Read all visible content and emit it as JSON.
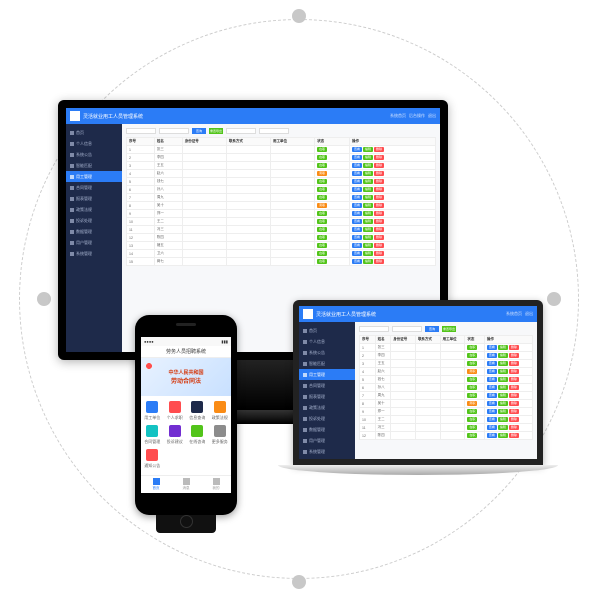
{
  "desktop": {
    "title": "灵活就业用工人员管理系统",
    "header_actions": [
      "系统首页",
      "后台操作",
      "退出"
    ],
    "sidebar": [
      {
        "label": "首页"
      },
      {
        "label": "个人信息"
      },
      {
        "label": "系统公告"
      },
      {
        "label": "智能匹配"
      },
      {
        "label": "用工管理",
        "active": true
      },
      {
        "label": "合同管理"
      },
      {
        "label": "报表管理"
      },
      {
        "label": "政策法规"
      },
      {
        "label": "投诉处理"
      },
      {
        "label": "数据管理"
      },
      {
        "label": "用户管理"
      },
      {
        "label": "系统管理"
      }
    ],
    "filter": {
      "search_btn": "查询",
      "reset_btn": "重置导出"
    },
    "columns": [
      "序号",
      "姓名",
      "身份证号",
      "联系方式",
      "用工单位",
      "状态",
      "操作"
    ],
    "rows": [
      {
        "c1": "1",
        "c2": "张三",
        "c3": "",
        "status": "在职",
        "actions": [
          "查看",
          "编辑",
          "删除"
        ]
      },
      {
        "c1": "2",
        "c2": "李四",
        "c3": "",
        "status": "在职",
        "actions": [
          "查看",
          "编辑",
          "删除"
        ]
      },
      {
        "c1": "3",
        "c2": "王五",
        "c3": "",
        "status": "在职",
        "actions": [
          "查看",
          "编辑",
          "删除"
        ]
      },
      {
        "c1": "4",
        "c2": "赵六",
        "c3": "",
        "status": "离职",
        "actions": [
          "查看",
          "编辑",
          "删除"
        ]
      },
      {
        "c1": "5",
        "c2": "钱七",
        "c3": "",
        "status": "在职",
        "actions": [
          "查看",
          "编辑",
          "删除"
        ]
      },
      {
        "c1": "6",
        "c2": "孙八",
        "c3": "",
        "status": "在职",
        "actions": [
          "查看",
          "编辑",
          "删除"
        ]
      },
      {
        "c1": "7",
        "c2": "周九",
        "c3": "",
        "status": "在职",
        "actions": [
          "查看",
          "编辑",
          "删除"
        ]
      },
      {
        "c1": "8",
        "c2": "吴十",
        "c3": "",
        "status": "离职",
        "actions": [
          "查看",
          "编辑",
          "删除"
        ]
      },
      {
        "c1": "9",
        "c2": "郑一",
        "c3": "",
        "status": "在职",
        "actions": [
          "查看",
          "编辑",
          "删除"
        ]
      },
      {
        "c1": "10",
        "c2": "王二",
        "c3": "",
        "status": "在职",
        "actions": [
          "查看",
          "编辑",
          "删除"
        ]
      },
      {
        "c1": "11",
        "c2": "冯三",
        "c3": "",
        "status": "在职",
        "actions": [
          "查看",
          "编辑",
          "删除"
        ]
      },
      {
        "c1": "12",
        "c2": "陈四",
        "c3": "",
        "status": "在职",
        "actions": [
          "查看",
          "编辑",
          "删除"
        ]
      },
      {
        "c1": "13",
        "c2": "褚五",
        "c3": "",
        "status": "在职",
        "actions": [
          "查看",
          "编辑",
          "删除"
        ]
      },
      {
        "c1": "14",
        "c2": "卫六",
        "c3": "",
        "status": "在职",
        "actions": [
          "查看",
          "编辑",
          "删除"
        ]
      },
      {
        "c1": "15",
        "c2": "蒋七",
        "c3": "",
        "status": "在职",
        "actions": [
          "查看",
          "编辑",
          "删除"
        ]
      }
    ]
  },
  "laptop": {
    "title": "灵活就业用工人员管理系统",
    "rows_count": 12
  },
  "phone": {
    "header": "劳务人员招聘系统",
    "banner_line1": "中华人民共和国",
    "banner_line2": "劳动合同法",
    "grid": [
      {
        "label": "用工单位",
        "color": "#2b7cf6"
      },
      {
        "label": "个人求职",
        "color": "#ff4d4f"
      },
      {
        "label": "信息查询",
        "color": "#1e2a4a"
      },
      {
        "label": "政策法规",
        "color": "#fa8c16"
      },
      {
        "label": "合同管理",
        "color": "#13c2c2"
      },
      {
        "label": "投诉建议",
        "color": "#722ed1"
      },
      {
        "label": "在线咨询",
        "color": "#52c41a"
      },
      {
        "label": "更多服务",
        "color": "#8c8c8c"
      },
      {
        "label": "通知公告",
        "color": "#ff4d4f"
      }
    ],
    "tabs": [
      {
        "label": "首页",
        "active": true
      },
      {
        "label": "消息"
      },
      {
        "label": "我的"
      }
    ]
  }
}
